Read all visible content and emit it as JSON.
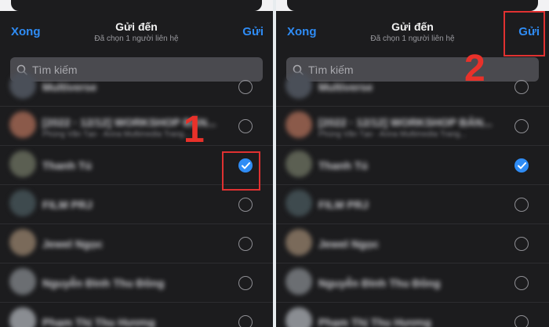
{
  "header": {
    "done_label": "Xong",
    "title": "Gửi đến",
    "subtitle": "Đã chọn 1 người liên hệ",
    "send_label": "Gửi"
  },
  "search": {
    "placeholder": "Tìm kiếm"
  },
  "contacts": [
    {
      "name": "Multiverse",
      "sub": "",
      "avatar_color": "#4a4f58",
      "checked": false
    },
    {
      "name": "[2022 · 12/12] WORKSHOP BẢN...",
      "sub": "Phùng Văn Tạo · Anna Multimedia Trang...",
      "avatar_color": "#8b5a4a",
      "checked": false
    },
    {
      "name": "Thanh Tú",
      "sub": "",
      "avatar_color": "#5b5f52",
      "checked": true
    },
    {
      "name": "FILM PRJ",
      "sub": "",
      "avatar_color": "#3e4a4e",
      "checked": false
    },
    {
      "name": "Jewel Ngọc",
      "sub": "",
      "avatar_color": "#7a6a5a",
      "checked": false
    },
    {
      "name": "Nguyễn Đình Thu Đông",
      "sub": "",
      "avatar_color": "#6b6e72",
      "checked": false
    },
    {
      "name": "Phạm Thị Thu Hương",
      "sub": "",
      "avatar_color": "#8a8d92",
      "checked": false
    }
  ],
  "annotations": {
    "step1": "1",
    "step2": "2",
    "color": "#e03131"
  },
  "colors": {
    "accent": "#2f8cf5",
    "background": "#1c1c1e"
  }
}
